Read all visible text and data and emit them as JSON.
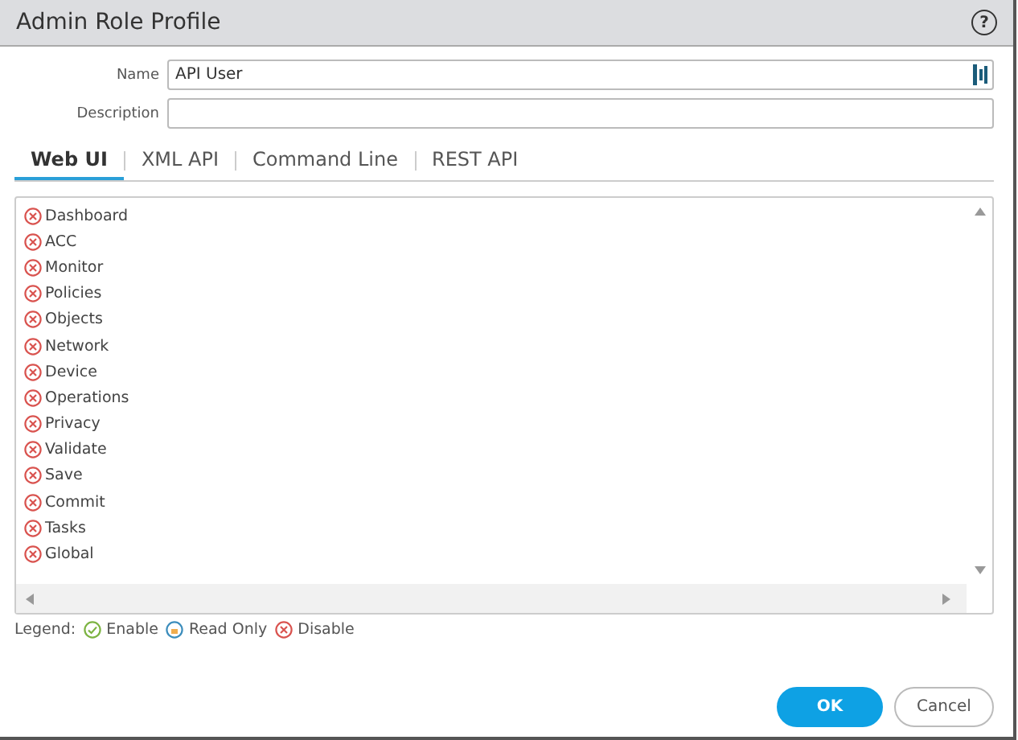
{
  "window": {
    "title": "Admin Role Profile",
    "help": "?"
  },
  "form": {
    "name_label": "Name",
    "name_value": "API User",
    "description_label": "Description"
  },
  "tabs": [
    {
      "label": "Web UI",
      "selected": true
    },
    {
      "label": "XML API",
      "selected": false
    },
    {
      "label": "Command Line",
      "selected": false
    },
    {
      "label": "REST API",
      "selected": false
    }
  ],
  "permissions": [
    {
      "label": "Dashboard",
      "kind": "disable"
    },
    {
      "label": "ACC",
      "kind": "disable"
    },
    {
      "label": "Monitor",
      "kind": "disable"
    },
    {
      "label": "Policies",
      "kind": "disable"
    },
    {
      "label": "Objects",
      "kind": "disable"
    },
    {
      "label": "Network",
      "kind": "disable"
    },
    {
      "label": "Device",
      "kind": "disable"
    },
    {
      "label": "Operations",
      "kind": "disable"
    },
    {
      "label": "Privacy",
      "kind": "disable"
    },
    {
      "label": "Validate",
      "kind": "disable"
    },
    {
      "label": "Save",
      "kind": "disable"
    },
    {
      "label": "Commit",
      "kind": "disable"
    },
    {
      "label": "Tasks",
      "kind": "disable"
    },
    {
      "label": "Global",
      "kind": "disable"
    }
  ],
  "legend": {
    "label": "Legend:",
    "items": [
      {
        "label": "Enable",
        "kind": "enable"
      },
      {
        "label": "Read Only",
        "kind": "readonly"
      },
      {
        "label": "Disable",
        "kind": "disable"
      }
    ]
  },
  "buttons": [
    {
      "label": "OK",
      "kind": "primary"
    },
    {
      "label": "Cancel",
      "kind": "secondary"
    }
  ]
}
